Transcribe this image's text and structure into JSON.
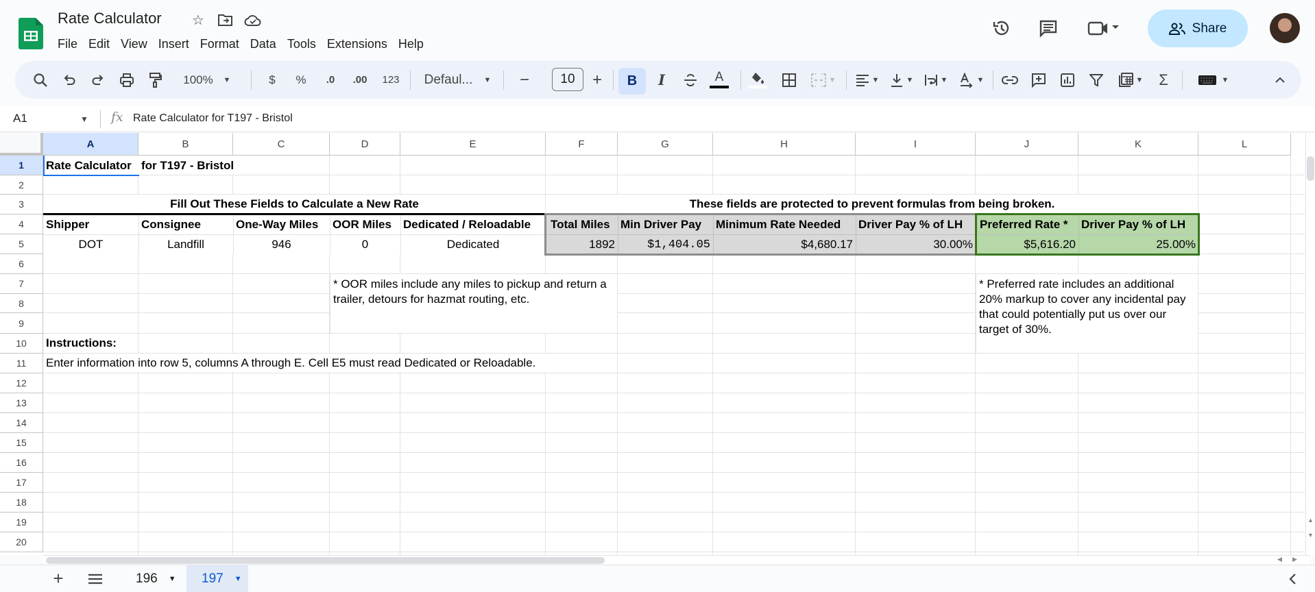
{
  "app": {
    "title": "Rate Calculator",
    "menu": [
      "File",
      "Edit",
      "View",
      "Insert",
      "Format",
      "Data",
      "Tools",
      "Extensions",
      "Help"
    ],
    "share_label": "Share",
    "icons": {
      "star": "star-icon",
      "move": "move-to-folder-icon",
      "cloud": "cloud-saved-icon",
      "history": "version-history-icon",
      "comments": "comments-icon",
      "meet": "meet-icon"
    }
  },
  "toolbar": {
    "zoom": "100%",
    "currency": "$",
    "percent": "%",
    "dec_decrease": ".0",
    "dec_increase": ".00",
    "number_format": "123",
    "font": "Defaul...",
    "font_size": "10",
    "bold": "B",
    "italic": "I",
    "text_color_glyph": "A"
  },
  "formula_bar": {
    "name_box": "A1",
    "fx": "fx",
    "content": "Rate Calculator for T197 - Bristol"
  },
  "sheet": {
    "columns": [
      "A",
      "B",
      "C",
      "D",
      "E",
      "F",
      "G",
      "H",
      "I",
      "J",
      "K",
      "L"
    ],
    "selected_column": "A",
    "rows": [
      "1",
      "2",
      "3",
      "4",
      "5",
      "6",
      "7",
      "8",
      "9",
      "10",
      "11",
      "12",
      "13",
      "14",
      "15",
      "16",
      "17",
      "18",
      "19",
      "20"
    ],
    "selected_row": "1",
    "cells": {
      "A1": "Rate Calculator",
      "B1": "for T197 - Bristol",
      "A3": "Fill Out These Fields to Calculate a New Rate",
      "F3": "These fields are protected to prevent formulas from being broken.",
      "A4": "Shipper",
      "B4": "Consignee",
      "C4": "One-Way Miles",
      "D4": "OOR Miles",
      "E4": "Dedicated / Reloadable",
      "F4": "Total Miles",
      "G4": "Min Driver Pay",
      "H4": "Minimum Rate Needed",
      "I4": "Driver Pay % of LH",
      "J4": "Preferred Rate *",
      "K4": "Driver Pay % of LH",
      "A5": "DOT",
      "B5": "Landfill",
      "C5": "946",
      "D5": "0",
      "E5": "Dedicated",
      "F5": "1892",
      "G5": "$1,404.05",
      "H5": "$4,680.17",
      "I5": "30.00%",
      "J5": "$5,616.20",
      "K5": "25.00%",
      "D7": "* OOR miles include any miles to pickup and return a trailer, detours for hazmat routing, etc.",
      "J7": "* Preferred rate includes an additional 20% markup to cover any incidental pay that could potentially put us over our target of 30%.",
      "A10": "Instructions:",
      "A11": "Enter information into row 5, columns A through E.  Cell E5 must read Dedicated or Reloadable."
    }
  },
  "sheet_tabs": [
    {
      "label": "196",
      "active": false
    },
    {
      "label": "197",
      "active": true
    }
  ],
  "colors": {
    "selection": "#d3e3fd",
    "protected_fill": "#d9d9d9",
    "preferred_fill": "#b6d7a8",
    "preferred_border": "#38761d",
    "share_bg": "#c2e7ff"
  }
}
